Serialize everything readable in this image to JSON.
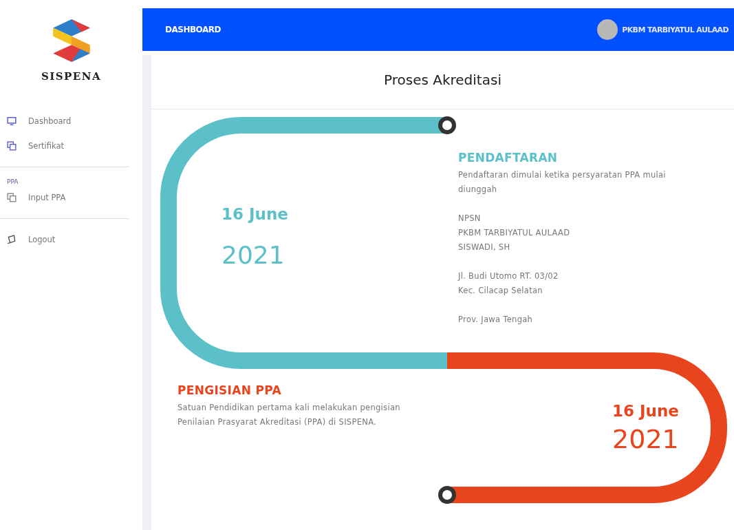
{
  "brand": {
    "name": "SISPENA"
  },
  "sidebar": {
    "groups": [
      {
        "items": [
          {
            "label": "Dashboard",
            "kind": "monitor"
          },
          {
            "label": "Sertifikat",
            "kind": "copy"
          }
        ]
      },
      {
        "label": "PPA",
        "items": [
          {
            "label": "Input PPA",
            "kind": "copy"
          }
        ]
      },
      {
        "items": [
          {
            "label": "Logout",
            "kind": "logout"
          }
        ]
      }
    ]
  },
  "header": {
    "title": "DASHBOARD",
    "user": "PKBM TARBIYATUL AULAAD"
  },
  "page": {
    "title": "Proses Akreditasi"
  },
  "stages": [
    {
      "title": "PENDAFTARAN",
      "color": "#5bc0c8",
      "day": "16 June",
      "year": "2021",
      "description": "Pendaftaran dimulai ketika persyaratan PPA mulai diunggah",
      "details": [
        [
          "NPSN",
          "PKBM TARBIYATUL AULAAD",
          "SISWADI, SH"
        ],
        [
          "Jl. Budi Utomo RT. 03/02",
          "Kec. Cilacap Selatan"
        ],
        [
          "Prov. Jawa Tengah"
        ]
      ]
    },
    {
      "title": "PENGISIAN PPA",
      "color": "#e8451e",
      "day": "16 June",
      "year": "2021",
      "description": "Satuan Pendidikan pertama kali melakukan pengisian Penilaian Prasyarat Akreditasi (PPA) di SISPENA."
    }
  ]
}
